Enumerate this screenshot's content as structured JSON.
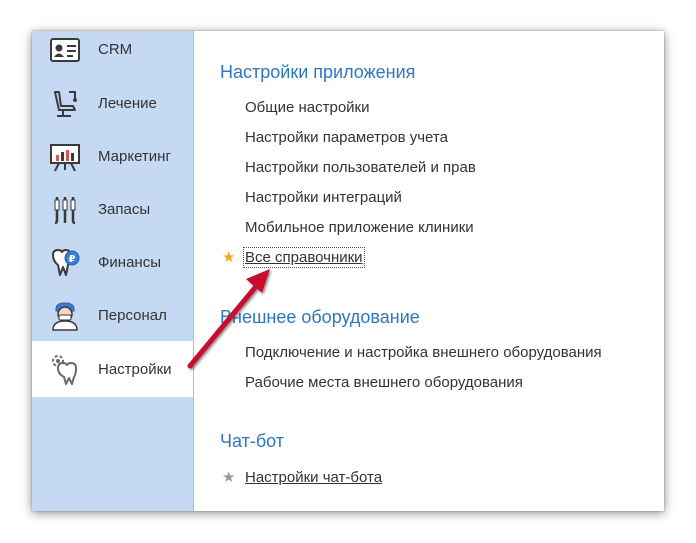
{
  "sidebar": {
    "items": [
      {
        "label": "CRM",
        "icon": "id-card-icon"
      },
      {
        "label": "Лечение",
        "icon": "dental-chair-icon"
      },
      {
        "label": "Маркетинг",
        "icon": "presentation-board-icon"
      },
      {
        "label": "Запасы",
        "icon": "dental-tools-icon"
      },
      {
        "label": "Финансы",
        "icon": "tooth-ruble-icon"
      },
      {
        "label": "Персонал",
        "icon": "doctor-icon"
      },
      {
        "label": "Настройки",
        "icon": "tooth-gear-icon",
        "active": true
      }
    ]
  },
  "sections": {
    "app_settings": {
      "title": "Настройки приложения",
      "links": [
        "Общие настройки",
        "Настройки параметров учета",
        "Настройки пользователей и прав",
        "Настройки интеграций",
        "Мобильное приложение клиники"
      ],
      "favorite_link": "Все справочники"
    },
    "external_equipment": {
      "title": "Внешнее оборудование",
      "links": [
        "Подключение и настройка внешнего оборудования",
        "Рабочие места внешнего оборудования"
      ]
    },
    "chatbot": {
      "title": "Чат-бот",
      "favorite_link": "Настройки чат-бота"
    }
  },
  "colors": {
    "sidebar_bg": "#c5d9f2",
    "section_title": "#2d77c2",
    "star_active": "#f5a623",
    "star_inactive": "#9a9a9a",
    "arrow": "#c8102e"
  }
}
